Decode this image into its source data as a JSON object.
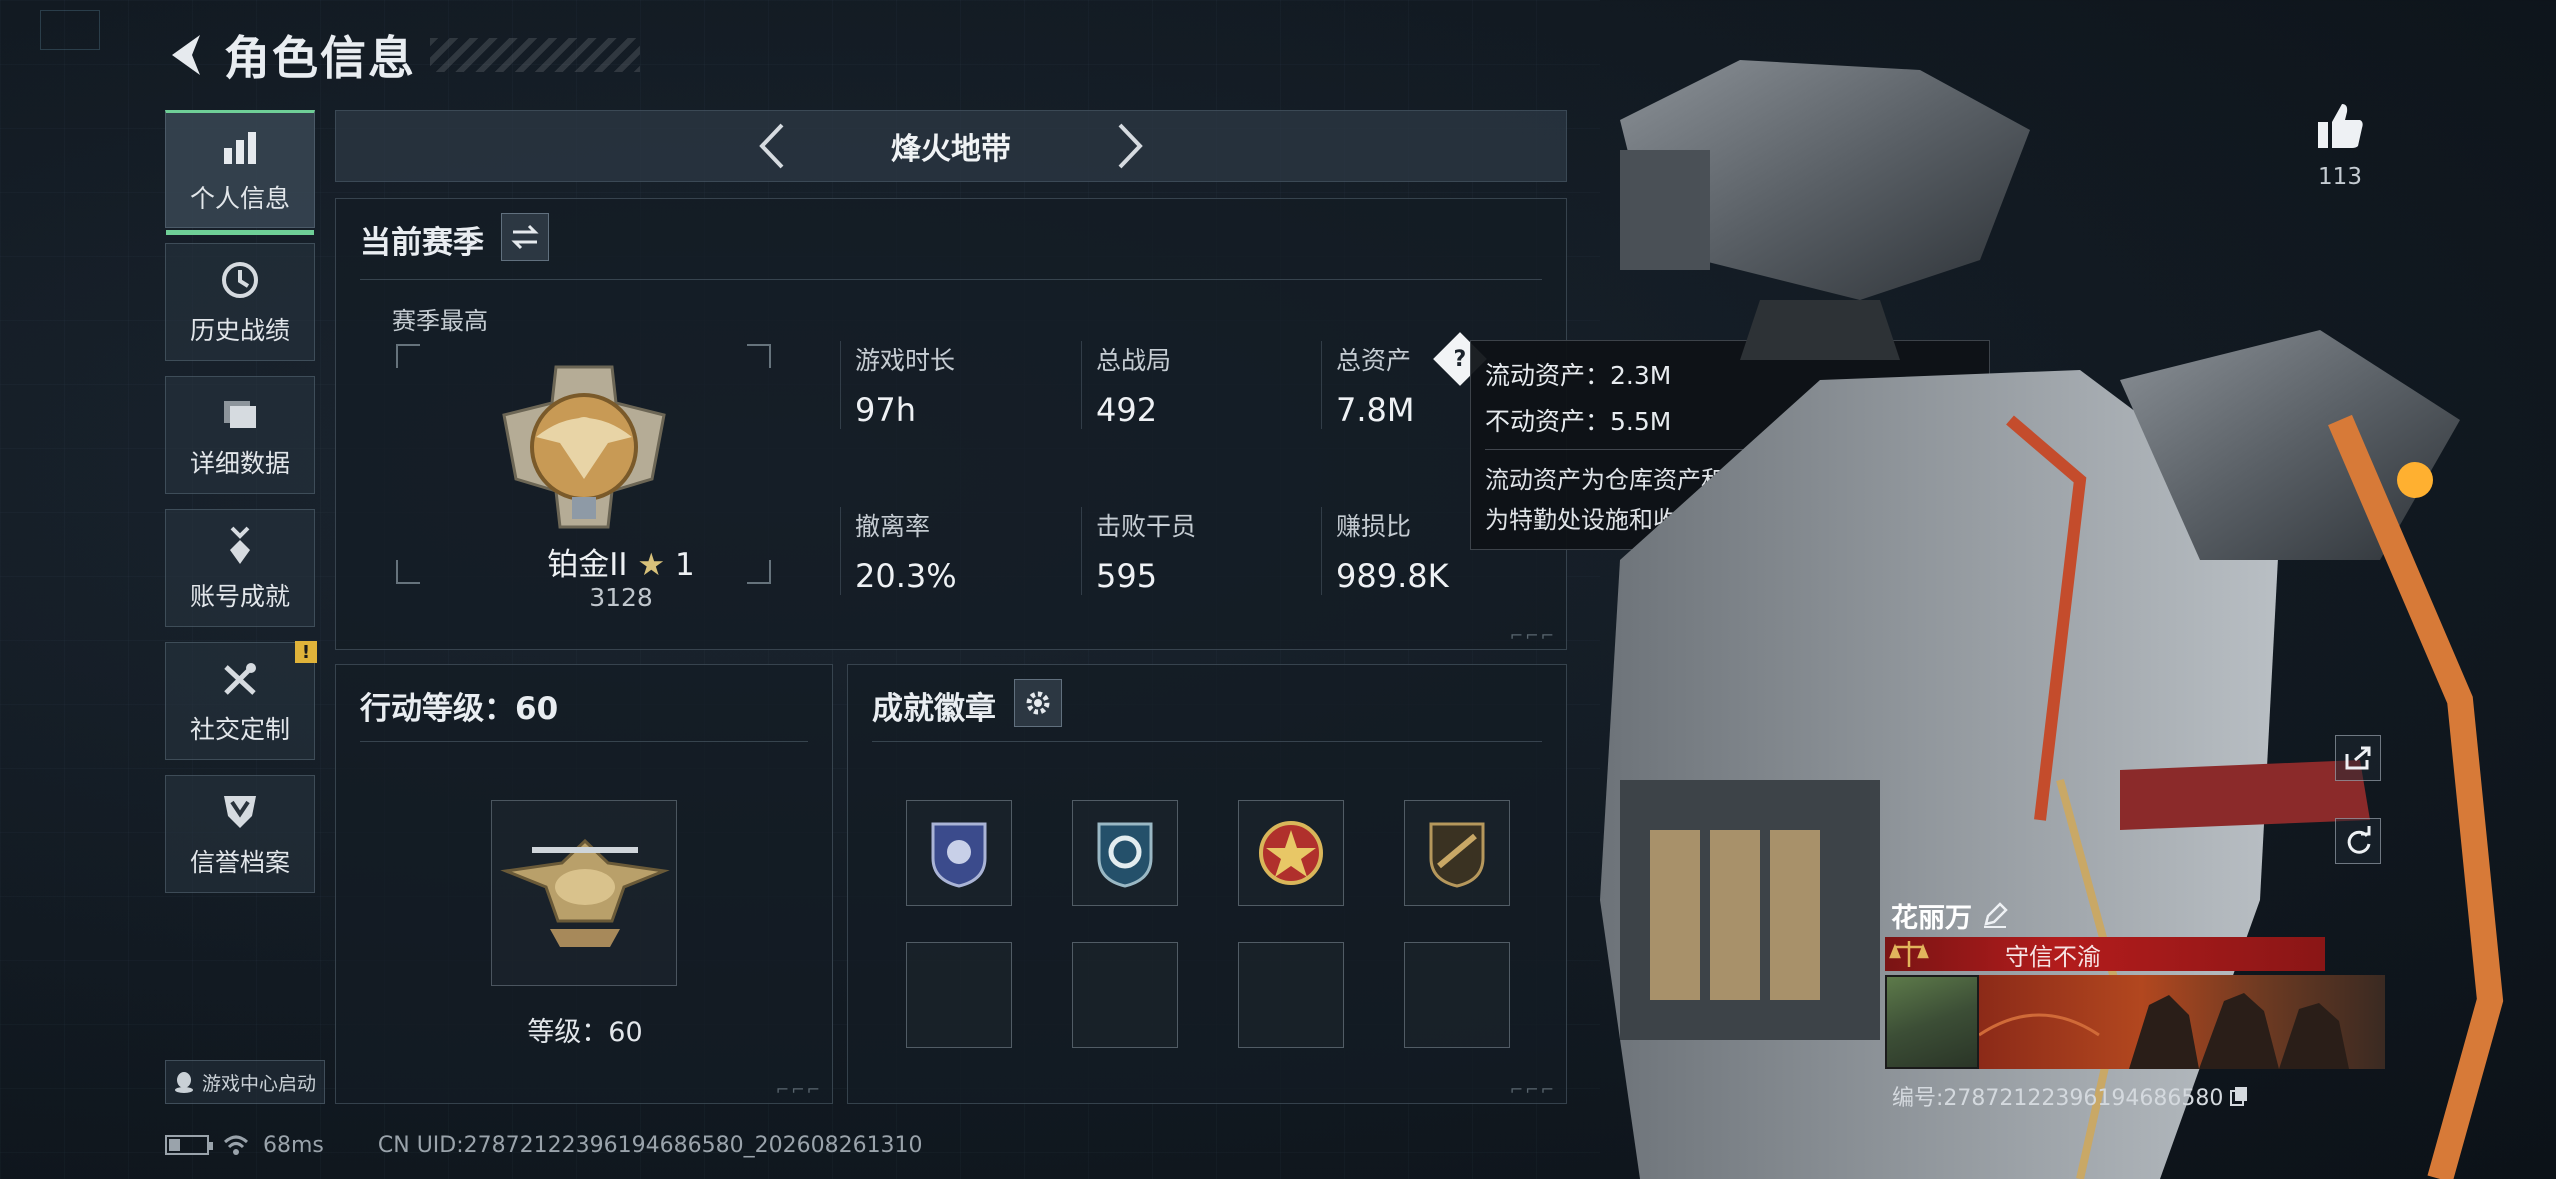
{
  "header": {
    "title": "角色信息"
  },
  "sidebar": {
    "items": [
      {
        "label": "个人信息",
        "icon": "bar-chart-icon",
        "active": true
      },
      {
        "label": "历史战绩",
        "icon": "clock-icon"
      },
      {
        "label": "详细数据",
        "icon": "folder-icon"
      },
      {
        "label": "账号成就",
        "icon": "medal-icon"
      },
      {
        "label": "社交定制",
        "icon": "tools-icon",
        "badge": "!"
      },
      {
        "label": "信誉档案",
        "icon": "shield-chevron-icon"
      }
    ],
    "game_center": "游戏中心启动"
  },
  "mode": {
    "name": "烽火地带"
  },
  "season": {
    "title": "当前赛季",
    "subtitle": "赛季最高",
    "rank_name": "铂金II",
    "rank_stars": "1",
    "rank_score": "3128",
    "stats": [
      {
        "label": "游戏时长",
        "value": "97h"
      },
      {
        "label": "总战局",
        "value": "492"
      },
      {
        "label": "总资产",
        "value": "7.8M"
      },
      {
        "label": "撤离率",
        "value": "20.3%"
      },
      {
        "label": "击败干员",
        "value": "595"
      },
      {
        "label": "赚损比",
        "value": "989.8K"
      }
    ]
  },
  "tooltip": {
    "liquid": "流动资产：2.3M",
    "fixed": "不动资产：5.5M",
    "desc_line1": "流动资产为仓库资产和哈夫币，不动资产",
    "desc_line2": "为特勤处设施和收藏室设施"
  },
  "action_level": {
    "title": "行动等级：60",
    "level_text": "等级：60"
  },
  "badges": {
    "title": "成就徽章",
    "items": [
      "police-badge-icon",
      "recycle-shield-icon",
      "star-medal-icon",
      "rifle-shield-icon",
      "",
      "",
      "",
      ""
    ]
  },
  "status": {
    "ping": "68ms",
    "uid": "CN UID:2787212239619468658​0_202608261310"
  },
  "profile": {
    "likes": "113",
    "name": "花丽万",
    "title_badge": "守信不渝",
    "id_text": "编号:2787212239619468658​0"
  },
  "colors": {
    "accent": "#6fcf97",
    "warning": "#e0b33a",
    "title_red": "#b31c1c"
  }
}
